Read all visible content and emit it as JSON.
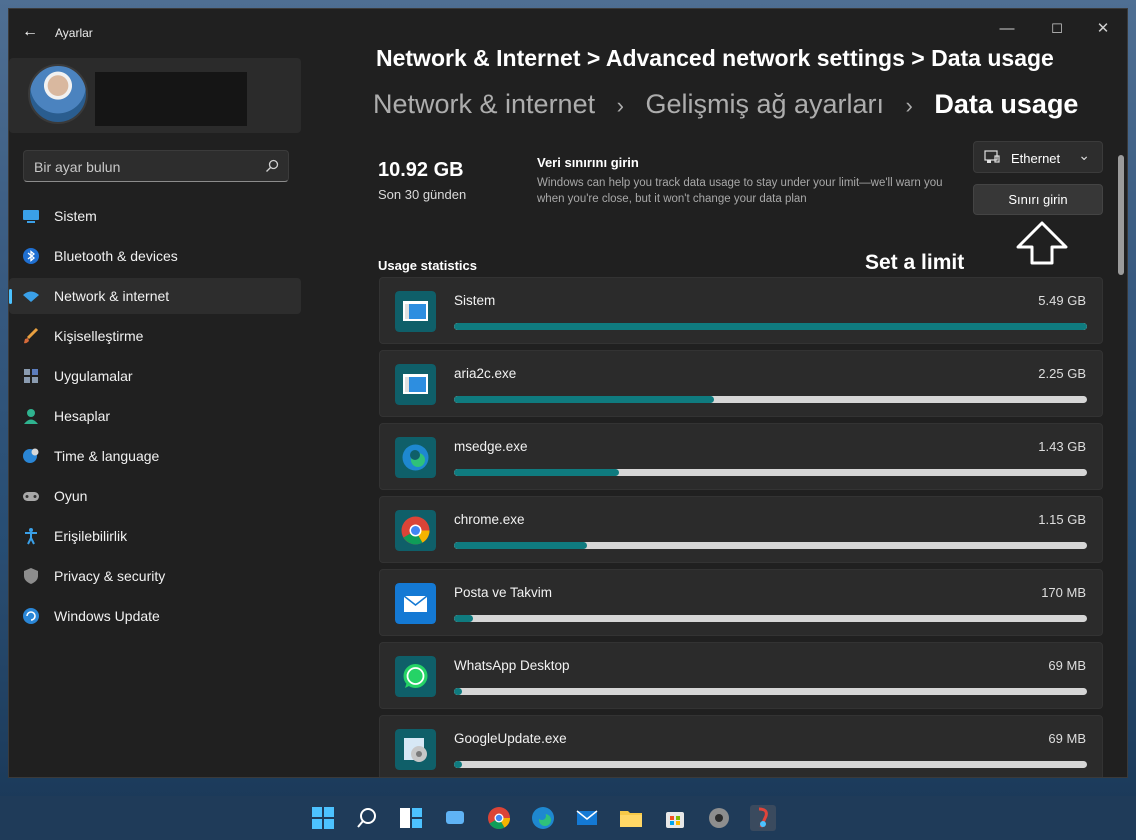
{
  "window": {
    "app_title": "Ayarlar",
    "minimize": "—",
    "maximize": "☐",
    "close": "✕"
  },
  "profile": {},
  "search": {
    "placeholder": "Bir ayar bulun"
  },
  "sidebar": {
    "items": [
      {
        "label": "Sistem",
        "icon": "monitor-icon"
      },
      {
        "label": "Bluetooth & devices",
        "icon": "bluetooth-icon"
      },
      {
        "label": "Network & internet",
        "icon": "wifi-icon",
        "active": true
      },
      {
        "label": "Kişiselleştirme",
        "icon": "brush-icon"
      },
      {
        "label": "Uygulamalar",
        "icon": "apps-icon"
      },
      {
        "label": "Hesaplar",
        "icon": "person-icon"
      },
      {
        "label": "Time & language",
        "icon": "globe-clock-icon"
      },
      {
        "label": "Oyun",
        "icon": "gamepad-icon"
      },
      {
        "label": "Erişilebilirlik",
        "icon": "accessibility-icon"
      },
      {
        "label": "Privacy & security",
        "icon": "shield-icon"
      },
      {
        "label": "Windows Update",
        "icon": "update-icon"
      }
    ]
  },
  "overlay": {
    "title": "Network & Internet > Advanced network settings > Data usage",
    "annotation": "Set a limit"
  },
  "breadcrumb": {
    "part1": "Network & internet",
    "part2": "Gelişmiş ağ ayarları",
    "current": "Data usage",
    "sep": "›"
  },
  "usage": {
    "total": "10.92 GB",
    "period": "Son 30 günden"
  },
  "limit": {
    "title": "Veri sınırını girin",
    "description": "Windows can help you track data usage to stay under your limit—we'll warn you when you're close, but it won't change your data plan",
    "button": "Sınırı girin"
  },
  "network_select": {
    "value": "Ethernet"
  },
  "stats": {
    "section_title": "Usage statistics",
    "apps": [
      {
        "name": "Sistem",
        "size": "5.49 GB",
        "fraction": 1.0,
        "icon": "system-app-icon"
      },
      {
        "name": "aria2c.exe",
        "size": "2.25 GB",
        "fraction": 0.41,
        "icon": "exe-app-icon"
      },
      {
        "name": "msedge.exe",
        "size": "1.43 GB",
        "fraction": 0.26,
        "icon": "edge-icon"
      },
      {
        "name": "chrome.exe",
        "size": "1.15 GB",
        "fraction": 0.21,
        "icon": "chrome-icon"
      },
      {
        "name": "Posta ve Takvim",
        "size": "170 MB",
        "fraction": 0.03,
        "icon": "mail-icon"
      },
      {
        "name": "WhatsApp Desktop",
        "size": "69 MB",
        "fraction": 0.013,
        "icon": "whatsapp-icon"
      },
      {
        "name": "GoogleUpdate.exe",
        "size": "69 MB",
        "fraction": 0.013,
        "icon": "google-update-icon"
      }
    ]
  },
  "colors": {
    "accent": "#4cc2ff",
    "bar_fill": "#0f7b7f",
    "bar_track": "#d6d6d6"
  },
  "taskbar": {
    "icons": [
      "windows-start-icon",
      "search-icon",
      "widgets-icon",
      "chat-icon",
      "chrome-icon",
      "edge-icon",
      "mail-icon",
      "file-explorer-icon",
      "store-icon",
      "settings-icon",
      "app-icon"
    ]
  }
}
